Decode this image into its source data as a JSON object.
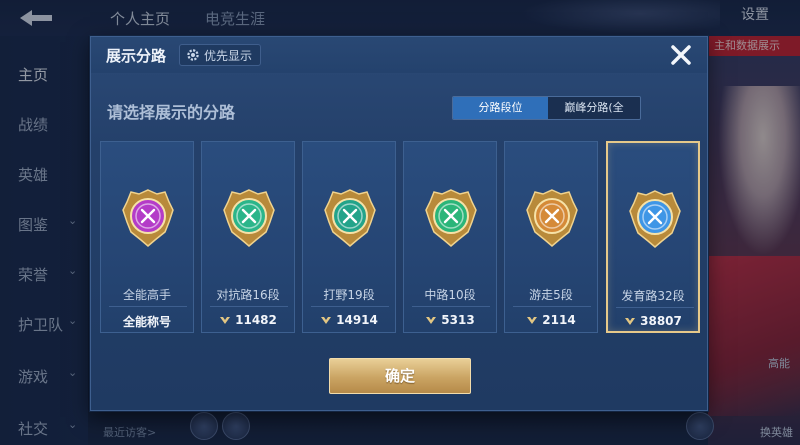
{
  "background": {
    "tabs": [
      "个人主页",
      "电竞生涯"
    ],
    "settings_label": "设置",
    "sidebar": [
      {
        "label": "主页",
        "has_chevron": false,
        "active": true
      },
      {
        "label": "战绩",
        "has_chevron": false,
        "active": false
      },
      {
        "label": "英雄",
        "has_chevron": false,
        "active": false
      },
      {
        "label": "图鉴",
        "has_chevron": true,
        "active": false
      },
      {
        "label": "荣誉",
        "has_chevron": true,
        "active": false
      },
      {
        "label": "护卫队",
        "has_chevron": true,
        "active": false
      },
      {
        "label": "游戏",
        "has_chevron": true,
        "active": false
      },
      {
        "label": "社交",
        "has_chevron": true,
        "active": false
      }
    ],
    "recent_visitors": "最近访客>",
    "right_pill": "主和数据展示",
    "right_labels": [
      "高能",
      "换英雄"
    ]
  },
  "dialog": {
    "title": "展示分路",
    "priority_button": "优先显示",
    "close_icon": "close-icon",
    "subtitle": "请选择展示的分路",
    "segment": {
      "options": [
        "分路段位",
        "巅峰分路(全国)"
      ],
      "selected_index": 0
    },
    "cards": [
      {
        "label": "全能高手",
        "stat": "全能称号",
        "stat_has_icon": false,
        "emblem": "all-round-emblem",
        "emblem_color": "#b43cc8",
        "selected": false
      },
      {
        "label": "对抗路16段",
        "stat": "11482",
        "stat_has_icon": true,
        "emblem": "clash-lane-emblem",
        "emblem_color": "#2bb58a",
        "selected": false
      },
      {
        "label": "打野19段",
        "stat": "14914",
        "stat_has_icon": true,
        "emblem": "jungle-emblem",
        "emblem_color": "#23a38a",
        "selected": false
      },
      {
        "label": "中路10段",
        "stat": "5313",
        "stat_has_icon": true,
        "emblem": "mid-lane-emblem",
        "emblem_color": "#2bb579",
        "selected": false
      },
      {
        "label": "游走5段",
        "stat": "2114",
        "stat_has_icon": true,
        "emblem": "roam-emblem",
        "emblem_color": "#d58a38",
        "selected": false
      },
      {
        "label": "发育路32段",
        "stat": "38807",
        "stat_has_icon": true,
        "emblem": "farm-lane-emblem",
        "emblem_color": "#3f96e6",
        "selected": true
      }
    ],
    "confirm_button": "确定"
  },
  "colors": {
    "dialog_bg": "#24406a",
    "segment_active": "#2f6fb9",
    "selected_border": "#e6c98a",
    "confirm_gold": "#caa463"
  }
}
